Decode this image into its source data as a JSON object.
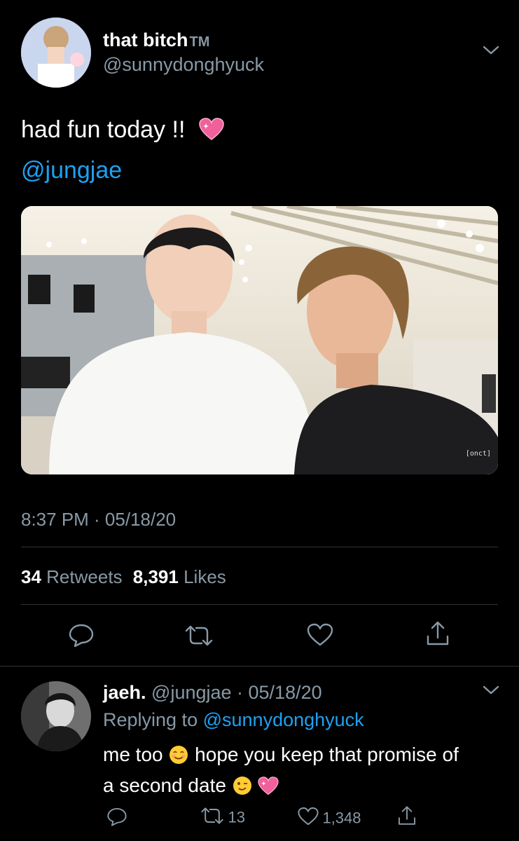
{
  "tweet": {
    "display_name": "that bitch",
    "name_suffix": "TM",
    "handle": "@sunnydonghyuck",
    "text": "had fun today !!",
    "mention": "@jungjae",
    "timestamp": "8:37 PM · 05/18/20",
    "retweets_count": "34",
    "retweets_label": "Retweets",
    "likes_count": "8,391",
    "likes_label": "Likes",
    "photo_watermark": "[onct]"
  },
  "reply": {
    "display_name": "jaeh.",
    "handle_date": "@jungjae · 05/18/20",
    "replying_prefix": "Replying to",
    "replying_to": "@sunnydonghyuck",
    "text_part1": "me too",
    "text_part2": "hope you keep that promise of",
    "text_part3": "a second date",
    "retweet_count": "13",
    "like_count": "1,348"
  },
  "icons": {
    "chevron": "chevron-down-icon",
    "reply": "reply-icon",
    "retweet": "retweet-icon",
    "like": "heart-icon",
    "share": "share-icon"
  },
  "colors": {
    "background": "#000000",
    "accent": "#1da1f2",
    "muted": "#8899a6",
    "divider": "#2f3336"
  }
}
